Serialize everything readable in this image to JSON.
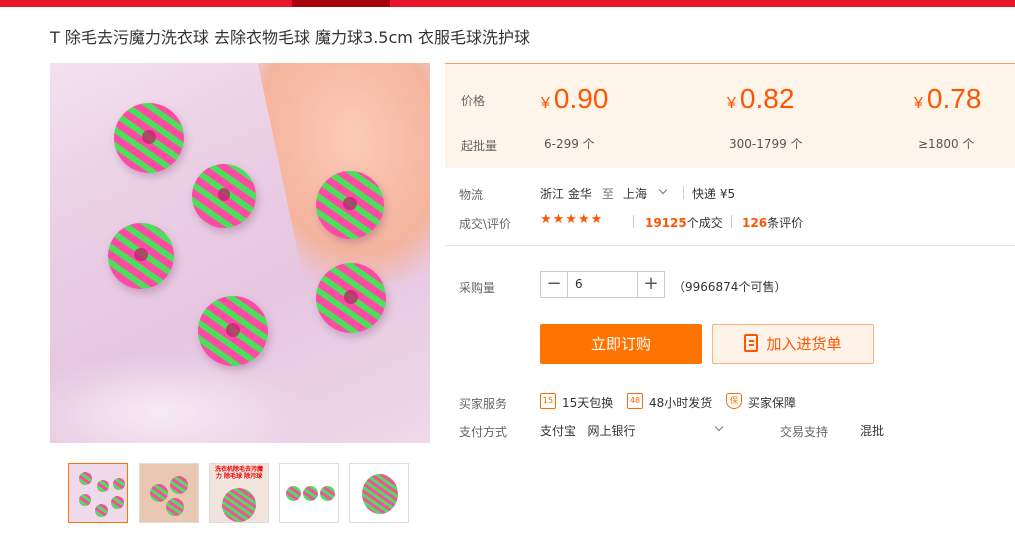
{
  "product": {
    "title": "T 除毛去污魔力洗衣球 去除衣物毛球 魔力球3.5cm 衣服毛球洗护球"
  },
  "price_box": {
    "price_label": "价格",
    "moq_label": "起批量",
    "currency": "¥",
    "tiers": [
      {
        "price": "0.90",
        "range": "6-299 个"
      },
      {
        "price": "0.82",
        "range": "300-1799 个"
      },
      {
        "price": "0.78",
        "range": "≥1800 个"
      }
    ]
  },
  "logistics": {
    "label": "物流",
    "from": "浙江 金华",
    "to_word": "至",
    "to": "上海",
    "express": "快递 ¥5"
  },
  "reviews": {
    "label": "成交\\评价",
    "stars": "★★★★★",
    "deals_count": "19125",
    "deals_text": "个成交",
    "review_count": "126",
    "review_text": "条评价"
  },
  "quantity": {
    "label": "采购量",
    "minus": "−",
    "value": "6",
    "plus": "+",
    "stock_text": "（9966874个可售）"
  },
  "buttons": {
    "buy_now": "立即订购",
    "add_to_list": "加入进货单"
  },
  "services": {
    "label": "买家服务",
    "items": [
      {
        "icon": "15",
        "text": "15天包换"
      },
      {
        "icon": "48",
        "text": "48小时发货"
      },
      {
        "icon": "保",
        "text": "买家保障"
      }
    ]
  },
  "payment": {
    "label": "支付方式",
    "methods": "支付宝   网上银行",
    "trade_support_label": "交易支持",
    "trade_support_value": "混批"
  },
  "thumbnails": {
    "thumb3_text": "洗衣机除毛去污魔力 除毛球 除污球"
  },
  "colors": {
    "accent": "#ff5500",
    "button": "#ff7300",
    "topbar": "#e8152a",
    "price_bg": "#fff4e9"
  }
}
